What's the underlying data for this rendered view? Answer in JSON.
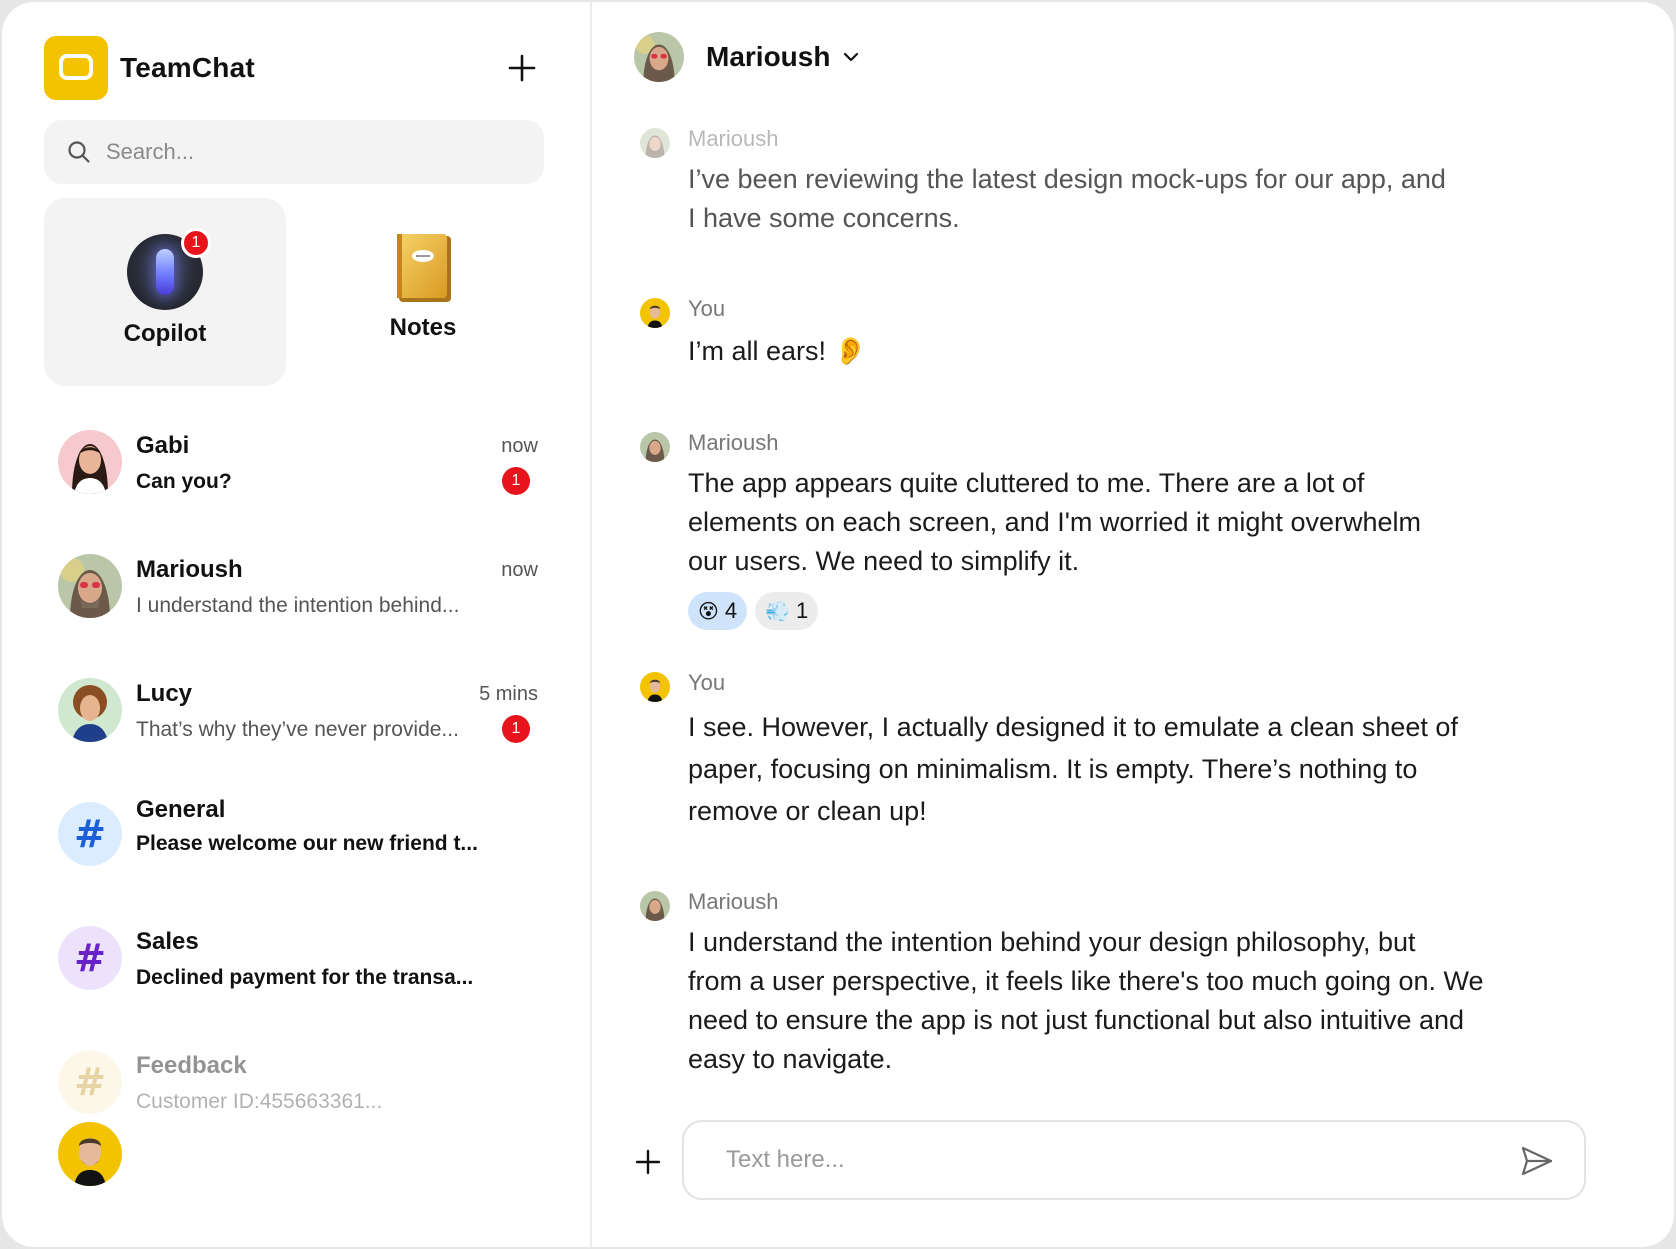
{
  "app": {
    "name": "TeamChat"
  },
  "search": {
    "placeholder": "Search..."
  },
  "shortcuts": [
    {
      "label": "Copilot",
      "badge": "1",
      "active": true
    },
    {
      "label": "Notes"
    }
  ],
  "chats": [
    {
      "name": "Gabi",
      "preview": "Can you?",
      "time": "now",
      "badge": "1",
      "unread": true
    },
    {
      "name": "Marioush",
      "preview": "I understand the intention behind...",
      "time": "now"
    },
    {
      "name": "Lucy",
      "preview": "That’s why they’ve never provide...",
      "time": "5 mins",
      "badge": "1"
    },
    {
      "name": "General",
      "preview": "Please welcome our new friend t...",
      "unread": true,
      "hash_color": "#1d5fd8",
      "hash_bg": "#dcecff"
    },
    {
      "name": "Sales",
      "preview": "Declined payment for the transa...",
      "unread": true,
      "hash_color": "#6b21c8",
      "hash_bg": "#ece2fb"
    },
    {
      "name": "Feedback",
      "preview": "Customer ID:455663361...",
      "hash_color": "#c9a23a",
      "hash_bg": "#fbefd2",
      "faded": true
    }
  ],
  "conversation": {
    "title": "Marioush",
    "messages": [
      {
        "author": "Marioush",
        "lines": [
          "I’ve been reviewing the latest design mock-ups for our app, and",
          "I have some concerns."
        ],
        "faded": true
      },
      {
        "author": "You",
        "lines": [
          "I’m all ears! 👂"
        ]
      },
      {
        "author": "Marioush",
        "lines": [
          "The app appears quite cluttered to me. There are a lot of",
          "elements on each screen, and I'm worried it might overwhelm",
          "our users. We need to simplify it."
        ],
        "reactions": [
          {
            "emoji": "😵",
            "count": "4",
            "mine": true
          },
          {
            "emoji": "💨",
            "count": "1",
            "mine": false
          }
        ]
      },
      {
        "author": "You",
        "lines": [
          "I see. However, I actually designed it to emulate a clean sheet of",
          "paper, focusing on minimalism. It is empty. There’s nothing to",
          "remove or clean up!"
        ]
      },
      {
        "author": "Marioush",
        "lines": [
          "I understand the intention behind your design philosophy, but",
          "from a user perspective, it feels like there's too much going on. We",
          "need to ensure the app is not just functional but also intuitive and",
          "easy to navigate."
        ]
      }
    ]
  },
  "composer": {
    "placeholder": "Text here..."
  },
  "colors": {
    "accent": "#f3c300",
    "badge": "#e8141c",
    "reaction_mine": "#cfe4fb"
  },
  "icons": [
    "teamchat-logo-icon",
    "plus-icon",
    "search-icon",
    "copilot-icon",
    "notes-icon",
    "chevron-down-icon",
    "send-icon"
  ]
}
